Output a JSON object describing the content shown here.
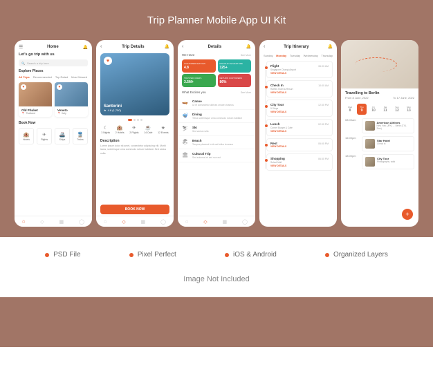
{
  "mockup": {
    "title": "Trip Planner Mobile App UI Kit",
    "features": [
      "PSD File",
      "Pixel Perfect",
      "iOS & Android",
      "Organized Layers"
    ],
    "image_note": "Image Not Included"
  },
  "phone1": {
    "header": "Home",
    "subtitle": "Let's go trip with us",
    "search_placeholder": "Search a trip here",
    "section_explore": "Explore Places",
    "tabs": [
      "All Trips",
      "Recommended",
      "Top Rated",
      "Most Viewed"
    ],
    "cards": [
      {
        "title": "Old Phuket",
        "location": "Thailand"
      },
      {
        "title": "Veneto",
        "location": "Italy"
      }
    ],
    "section_book": "Book Now",
    "book_items": [
      "Hotels",
      "Flights",
      "Ships",
      "Trains"
    ]
  },
  "phone2": {
    "header": "Trip Details",
    "hero_title": "Santorini",
    "hero_rating": "4.8 (1,750)",
    "stats": [
      "3 Nights",
      "2 Hotels",
      "2 Flights",
      "14 Cafe",
      "12 Events"
    ],
    "desc_title": "Description",
    "desc_text": "Lorem ipsum dolor sit amet, consectetur adipiscing elit. Morbi lacus, scelerisque urna commodo rutrum habitant. Sed varius nulla.",
    "cta": "BOOK NOW"
  },
  "phone3": {
    "header": "Details",
    "we_have": "We Have",
    "see_more": "See More",
    "tiles": [
      {
        "label": "CUSTOMER RATINGS",
        "value": "4.8"
      },
      {
        "label": "MONTHLY ADVENTURE",
        "value": "125+"
      },
      {
        "label": "TRUSTED USERS",
        "value": "3.5M+"
      },
      {
        "label": "RETURN CUSTOMERS",
        "value": "86%"
      }
    ],
    "excites": "What Excites you",
    "activities": [
      {
        "title": "Canoe",
        "sub": "Ut et consectetur ultrices ornare vivamus"
      },
      {
        "title": "Diving",
        "sub": "Tellus scelerisque urna commodo rutrum habitant"
      },
      {
        "title": "Ski",
        "sub": "Sed varius nulla"
      },
      {
        "title": "Beach",
        "sub": "Tempus placerat in id sed tellus vivamus"
      },
      {
        "title": "Cultural Trip",
        "sub": "Sed euismod et sed non est"
      }
    ]
  },
  "phone4": {
    "header": "Trip Itinerary",
    "days": [
      "Sunday",
      "Monday",
      "Tuesday",
      "Wednesday",
      "Thursday"
    ],
    "events": [
      {
        "title": "Flight",
        "time": "06:00 AM",
        "sub": "Singapore Changi Airport",
        "link": "VIEW DETAILS"
      },
      {
        "title": "Check In",
        "time": "10:00 AM",
        "sub": "Raffles Hotel & Resort",
        "link": "VIEW DETAILS"
      },
      {
        "title": "City Tour",
        "time": "12:30 PM",
        "sub": "5 Stops",
        "link": "VIEW DETAILS"
      },
      {
        "title": "Lunch",
        "time": "02:30 PM",
        "sub": "Corner Burger & Cafe",
        "link": "VIEW DETAILS"
      },
      {
        "title": "Rest",
        "time": "05:00 PM",
        "sub": "",
        "link": "VIEW DETAILS"
      },
      {
        "title": "Shopping",
        "time": "06:30 PM",
        "sub": "Select Mall",
        "link": "VIEW DETAILS"
      }
    ]
  },
  "phone5": {
    "title": "Travelling to Berlin",
    "date_from": "From 8 June, 2022",
    "date_to": "To 17 June, 2022",
    "calendar": [
      {
        "day": "Wed",
        "num": "8"
      },
      {
        "day": "Thu",
        "num": "9"
      },
      {
        "day": "Fri",
        "num": "10"
      },
      {
        "day": "Sat",
        "num": "11"
      },
      {
        "day": "Sun",
        "num": "12"
      },
      {
        "day": "Mon",
        "num": "13"
      }
    ],
    "itinerary": [
      {
        "time": "08:00am",
        "title": "American Airlines",
        "sub": "New York (JFK) → Berlin (TXL 2hrs)"
      },
      {
        "time": "16:00pm",
        "title": "Star Hotel",
        "sub": "Check in"
      },
      {
        "time": "18:00pm",
        "title": "City Tour",
        "sub": "Photographs, walk"
      }
    ]
  }
}
